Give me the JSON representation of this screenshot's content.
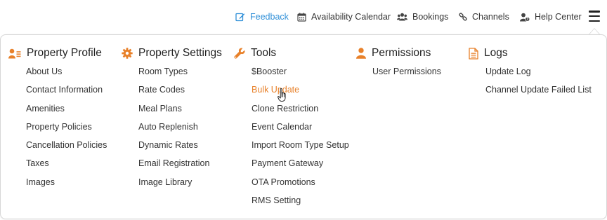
{
  "topnav": {
    "feedback": "Feedback",
    "availability_calendar": "Availability Calendar",
    "bookings": "Bookings",
    "channels": "Channels",
    "help_center": "Help Center"
  },
  "menu": {
    "property_profile": {
      "title": "Property Profile",
      "items": [
        "About Us",
        "Contact Information",
        "Amenities",
        "Property Policies",
        "Cancellation Policies",
        "Taxes",
        "Images"
      ]
    },
    "property_settings": {
      "title": "Property Settings",
      "items": [
        "Room Types",
        "Rate Codes",
        "Meal Plans",
        "Auto Replenish",
        "Dynamic Rates",
        "Email Registration",
        "Image Library"
      ]
    },
    "tools": {
      "title": "Tools",
      "items": [
        "$Booster",
        "Bulk Update",
        "Clone Restriction",
        "Event Calendar",
        "Import Room Type Setup",
        "Payment Gateway",
        "OTA Promotions",
        "RMS Setting"
      ],
      "active_item": "Bulk Update"
    },
    "permissions": {
      "title": "Permissions",
      "items": [
        "User Permissions"
      ]
    },
    "logs": {
      "title": "Logs",
      "items": [
        "Update Log",
        "Channel Update Failed List"
      ]
    }
  },
  "colors": {
    "accent_orange": "#e8812a",
    "feedback_blue": "#2f8fd8",
    "text": "#333333",
    "border": "#d6d6d6"
  },
  "icons": {
    "feedback": "edit-icon",
    "availability_calendar": "calendar-icon",
    "bookings": "users-icon",
    "channels": "link-icon",
    "help_center": "user-question-icon",
    "menu": "hamburger-icon",
    "property_profile": "user-list-icon",
    "property_settings": "gear-icon",
    "tools": "wrench-icon",
    "permissions": "user-icon",
    "logs": "document-icon"
  }
}
